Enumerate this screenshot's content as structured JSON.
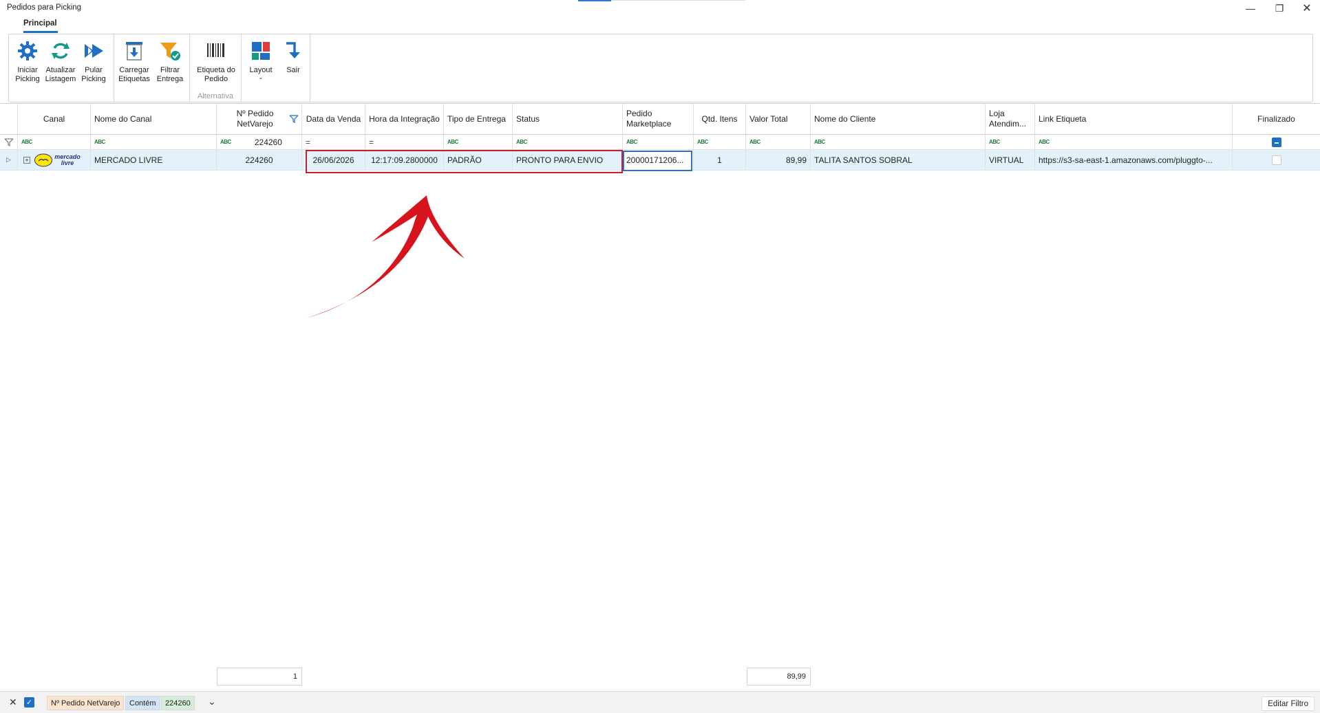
{
  "window": {
    "title": "Pedidos para Picking"
  },
  "ribbon": {
    "tab": "Principal",
    "buttons": {
      "iniciar": "Iniciar Picking",
      "atualizar": "Atualizar Listagem",
      "pular": "Pular Picking",
      "carregar": "Carregar Etiquetas",
      "filtrar": "Filtrar Entrega",
      "etiqueta": "Etiqueta do Pedido",
      "layout": "Layout",
      "sair": "Sair"
    },
    "group_alternativa": "Alternativa"
  },
  "grid": {
    "columns": [
      "Canal",
      "Nome do Canal",
      "Nº Pedido NetVarejo",
      "Data da Venda",
      "Hora da Integração",
      "Tipo de Entrega",
      "Status",
      "Pedido Marketplace",
      "Qtd. Itens",
      "Valor Total",
      "Nome do Cliente",
      "Loja Atendim...",
      "Link Etiqueta",
      "Finalizado"
    ],
    "filter_row": {
      "abc": "ABC",
      "eq": "=",
      "pedido_value": "224260"
    },
    "row": {
      "canal_logo": "mercado livre",
      "nome_canal": "MERCADO LIVRE",
      "pedido": "224260",
      "data_venda": "26/06/2026",
      "hora_integracao": "12:17:09.2800000",
      "tipo_entrega": "PADRÃO",
      "status": "PRONTO PARA ENVIO",
      "pedido_marketplace": "20000171206...",
      "qtd_itens": "1",
      "valor_total": "89,99",
      "nome_cliente": "TALITA SANTOS SOBRAL",
      "loja": "VIRTUAL",
      "link_etiqueta": "https://s3-sa-east-1.amazonaws.com/pluggto-..."
    }
  },
  "summary": {
    "count": "1",
    "total": "89,99"
  },
  "filter_bar": {
    "field": "Nº Pedido NetVarejo",
    "operator": "Contém",
    "value": "224260",
    "edit_label": "Editar Filtro"
  }
}
